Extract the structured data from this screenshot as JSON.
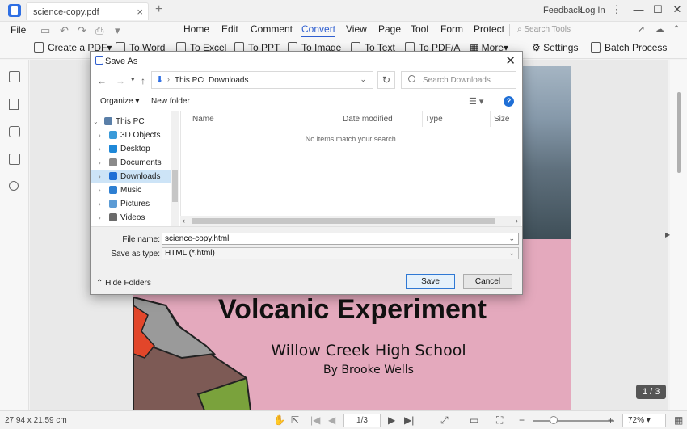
{
  "titlebar": {
    "tab_title": "science-copy.pdf",
    "tab_close": "×",
    "tab_add": "+",
    "feedback": "Feedback",
    "login": "Log In",
    "more": "⋮",
    "minimize": "—",
    "maximize": "☐",
    "close": "✕"
  },
  "menubar": {
    "file": "File",
    "items": [
      "Home",
      "Edit",
      "Comment",
      "Convert",
      "View",
      "Page",
      "Tool",
      "Form",
      "Protect"
    ],
    "active": "Convert",
    "search_tools": "Search Tools"
  },
  "toolbar": {
    "create_pdf": "Create a PDF",
    "to_word": "To Word",
    "to_excel": "To Excel",
    "to_ppt": "To PPT",
    "to_image": "To Image",
    "to_text": "To Text",
    "to_pdfa": "To PDF/A",
    "more": "More",
    "settings": "Settings",
    "batch_process": "Batch Process"
  },
  "document": {
    "title": "Volcanic Experiment",
    "school": "Willow Creek High School",
    "author": "By Brooke Wells",
    "page_indicator": "1 / 3"
  },
  "statusbar": {
    "page_size": "27.94 x 21.59 cm",
    "page_input": "1/3",
    "zoom": "72%"
  },
  "dialog": {
    "title": "Save As",
    "close": "✕",
    "breadcrumb": [
      "This PC",
      "Downloads"
    ],
    "search_placeholder": "Search Downloads",
    "organize": "Organize ▾",
    "new_folder": "New folder",
    "tree": [
      {
        "label": "This PC",
        "icon_color": "#5a7fa8"
      },
      {
        "label": "3D Objects",
        "icon_color": "#3a9ad9"
      },
      {
        "label": "Desktop",
        "icon_color": "#1e88d8"
      },
      {
        "label": "Documents",
        "icon_color": "#8a8a8a"
      },
      {
        "label": "Downloads",
        "icon_color": "#1f6fd6"
      },
      {
        "label": "Music",
        "icon_color": "#2d7fd2"
      },
      {
        "label": "Pictures",
        "icon_color": "#5b9bd5"
      },
      {
        "label": "Videos",
        "icon_color": "#6b6b6b"
      }
    ],
    "selected_tree_item": "Downloads",
    "columns": [
      "Name",
      "Date modified",
      "Type",
      "Size"
    ],
    "empty_message": "No items match your search.",
    "file_name_label": "File name:",
    "file_name_value": "science-copy.html",
    "save_type_label": "Save as type:",
    "save_type_value": "HTML (*.html)",
    "hide_folders": "Hide Folders",
    "save_button": "Save",
    "cancel_button": "Cancel"
  },
  "colors": {
    "accent": "#2f5fd0",
    "page_pink": "#e4a9bd",
    "selection": "#cde4f7"
  }
}
